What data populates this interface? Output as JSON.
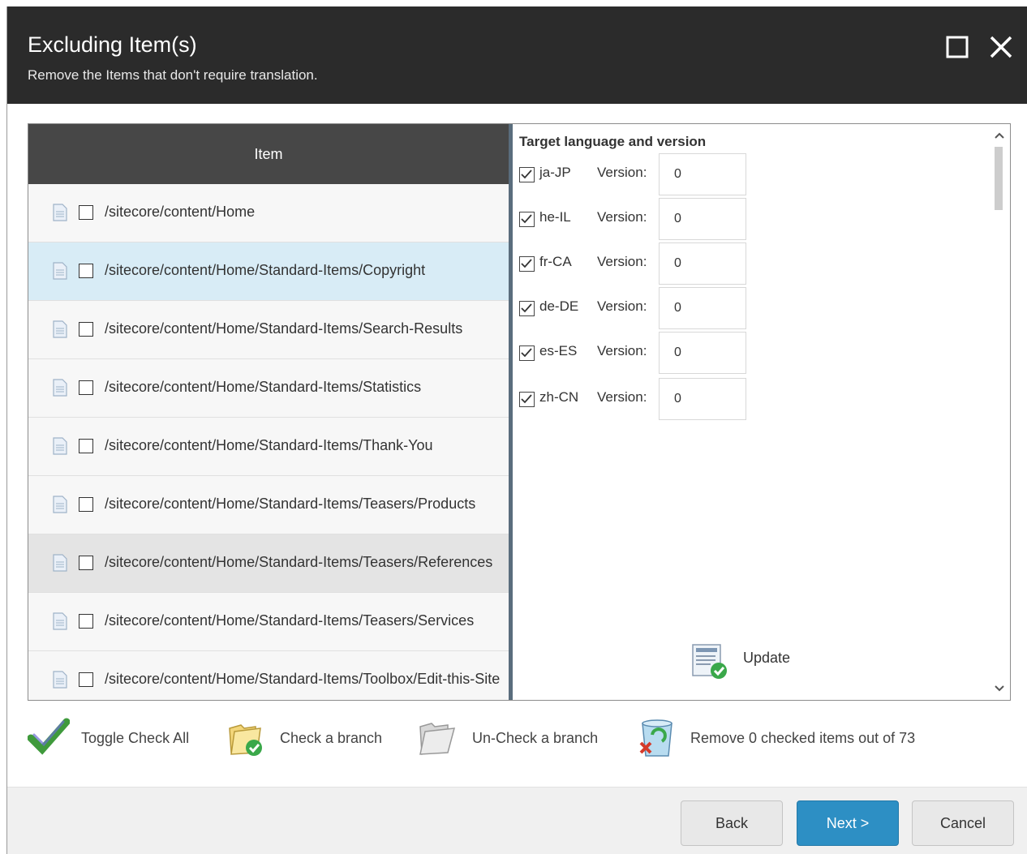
{
  "dialog": {
    "title": "Excluding Item(s)",
    "subtitle": "Remove the Items that don't require translation."
  },
  "items_table": {
    "column_header": "Item",
    "rows": [
      {
        "path": "/sitecore/content/Home",
        "checked": false
      },
      {
        "path": "/sitecore/content/Home/Standard-Items/Copyright",
        "checked": false,
        "state": "selected"
      },
      {
        "path": "/sitecore/content/Home/Standard-Items/Search-Results",
        "checked": false
      },
      {
        "path": "/sitecore/content/Home/Standard-Items/Statistics",
        "checked": false
      },
      {
        "path": "/sitecore/content/Home/Standard-Items/Thank-You",
        "checked": false
      },
      {
        "path": "/sitecore/content/Home/Standard-Items/Teasers/Products",
        "checked": false
      },
      {
        "path": "/sitecore/content/Home/Standard-Items/Teasers/References",
        "checked": false,
        "state": "hover"
      },
      {
        "path": "/sitecore/content/Home/Standard-Items/Teasers/Services",
        "checked": false
      },
      {
        "path": "/sitecore/content/Home/Standard-Items/Toolbox/Edit-this-Site",
        "checked": false
      }
    ]
  },
  "languages": {
    "title": "Target language and version",
    "version_label": "Version:",
    "items": [
      {
        "code": "ja-JP",
        "checked": true,
        "version": "0"
      },
      {
        "code": "he-IL",
        "checked": true,
        "version": "0"
      },
      {
        "code": "fr-CA",
        "checked": true,
        "version": "0"
      },
      {
        "code": "de-DE",
        "checked": true,
        "version": "0"
      },
      {
        "code": "es-ES",
        "checked": true,
        "version": "0"
      },
      {
        "code": "zh-CN",
        "checked": true,
        "version": "0"
      }
    ],
    "update_label": "Update"
  },
  "toolbar": {
    "toggle_check_all": "Toggle Check All",
    "check_branch": "Check a branch",
    "uncheck_branch": "Un-Check a branch",
    "remove_checked": "Remove 0 checked items out of 73"
  },
  "footer": {
    "back": "Back",
    "next": "Next >",
    "cancel": "Cancel"
  },
  "colors": {
    "titlebar": "#2b2b2b",
    "header": "#474747",
    "selected_row": "#d8ecf6",
    "primary_button": "#2d8fc4"
  }
}
